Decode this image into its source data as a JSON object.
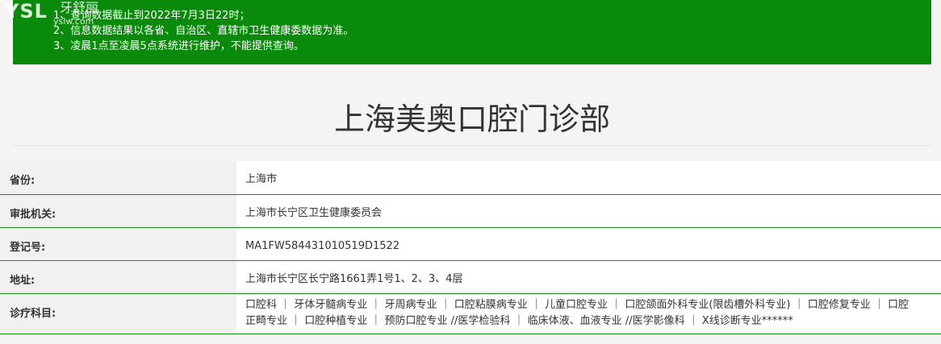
{
  "watermark": {
    "logo": "YSL",
    "name": "牙舒丽",
    "url": "yslw.com"
  },
  "notice": {
    "lines": [
      "1、查询数据截止到2022年7月3日22时；",
      "2、信息数据结果以各省、自治区、直辖市卫生健康委数据为准。",
      "3、凌晨1点至凌晨5点系统进行维护，不能提供查询。"
    ]
  },
  "page": {
    "title": "上海美奥口腔门诊部"
  },
  "info": {
    "rows": [
      {
        "label": "省份:",
        "value": "上海市"
      },
      {
        "label": "审批机关:",
        "value": "上海市长宁区卫生健康委员会"
      },
      {
        "label": "登记号:",
        "value": "MA1FW584431010519D1522"
      },
      {
        "label": "地址:",
        "value": "上海市长宁区长宁路1661弄1号1、2、3、4层"
      },
      {
        "label": "诊疗科目:",
        "value": "口腔科 ｜ 牙体牙髓病专业 ｜ 牙周病专业 ｜ 口腔粘膜病专业 ｜ 儿童口腔专业 ｜ 口腔颌面外科专业(限齿槽外科专业) ｜ 口腔修复专业 ｜ 口腔正畸专业 ｜ 口腔种植专业 ｜ 预防口腔专业 //医学检验科 ｜ 临床体液、血液专业 //医学影像科 ｜ X线诊断专业******"
      }
    ]
  },
  "colors": {
    "notice_bg": "#0a8a0a",
    "row_border": "#1e8a1e",
    "label_bg": "#f1f1f1",
    "value_bg": "#ffffff"
  }
}
